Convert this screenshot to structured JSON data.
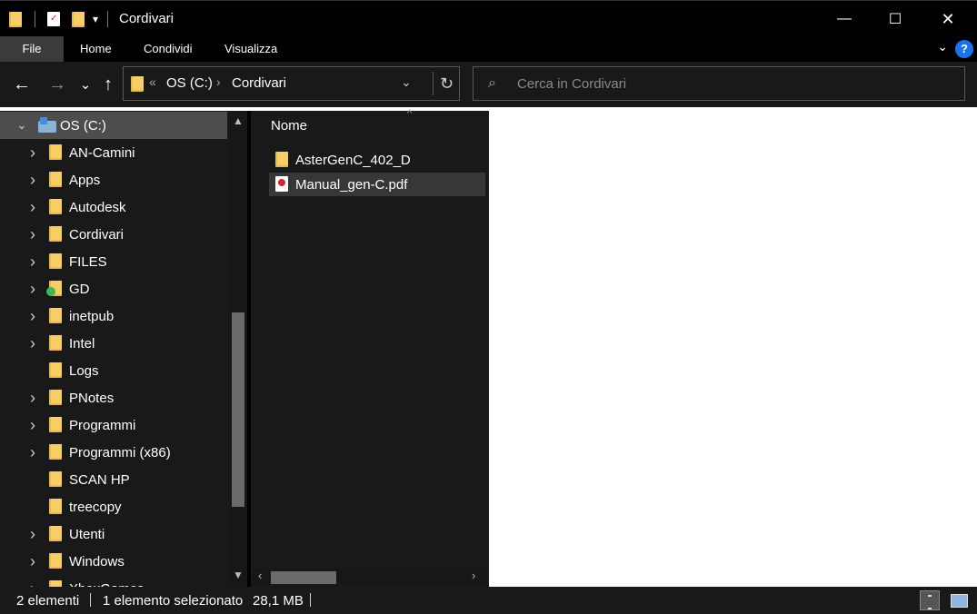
{
  "window": {
    "title": "Cordivari",
    "quick_access_dropdown": "▾",
    "minimize": "—",
    "maximize": "☐",
    "close": "✕"
  },
  "ribbon": {
    "tabs": [
      "File",
      "Home",
      "Condividi",
      "Visualizza"
    ],
    "collapse": "⌄",
    "help": "?"
  },
  "navbar": {
    "back": "←",
    "forward": "→",
    "recent": "⌄",
    "up": "↑",
    "breadcrumb_overflow": "«",
    "breadcrumbs": [
      "OS (C:)",
      "Cordivari"
    ],
    "crumb_separator": "›",
    "address_dropdown": "⌄",
    "refresh": "↻",
    "search_placeholder": "Cerca in Cordivari"
  },
  "tree": {
    "root": "OS (C:)",
    "items": [
      {
        "label": "AN-Camini",
        "expandable": true
      },
      {
        "label": "Apps",
        "expandable": true
      },
      {
        "label": "Autodesk",
        "expandable": true
      },
      {
        "label": "Cordivari",
        "expandable": true
      },
      {
        "label": "FILES",
        "expandable": true
      },
      {
        "label": "GD",
        "expandable": true
      },
      {
        "label": "inetpub",
        "expandable": true
      },
      {
        "label": "Intel",
        "expandable": true
      },
      {
        "label": "Logs",
        "expandable": false
      },
      {
        "label": "PNotes",
        "expandable": true
      },
      {
        "label": "Programmi",
        "expandable": true
      },
      {
        "label": "Programmi (x86)",
        "expandable": true
      },
      {
        "label": "SCAN HP",
        "expandable": false
      },
      {
        "label": "treecopy",
        "expandable": false
      },
      {
        "label": "Utenti",
        "expandable": true
      },
      {
        "label": "Windows",
        "expandable": true
      },
      {
        "label": "XboxGames",
        "expandable": true
      }
    ]
  },
  "files": {
    "column_name": "Nome",
    "sort_indicator": "^",
    "items": [
      {
        "name": "AsterGenC_402_D",
        "type": "folder",
        "selected": false
      },
      {
        "name": "Manual_gen-C.pdf",
        "type": "pdf",
        "selected": true
      }
    ]
  },
  "status": {
    "count": "2 elementi",
    "selection": "1 elemento selezionato",
    "size": "28,1 MB"
  },
  "colors": {
    "accent_blue": "#1a73e8",
    "folder_yellow": "#f5cf66",
    "pane_bg": "#191919",
    "selection_bg": "#4d4d4d"
  }
}
